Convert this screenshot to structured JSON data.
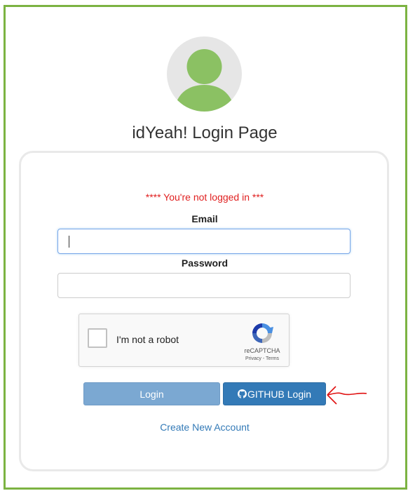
{
  "page": {
    "title": "idYeah! Login Page",
    "status_message": "**** You're not logged in ***"
  },
  "form": {
    "email_label": "Email",
    "email_value": "",
    "password_label": "Password",
    "password_value": ""
  },
  "captcha": {
    "checkbox_label": "I'm not a robot",
    "brand": "reCAPTCHA",
    "links": "Privacy - Terms"
  },
  "buttons": {
    "login": "Login",
    "github": "GITHUB Login"
  },
  "links": {
    "create_account": "Create New Account"
  },
  "colors": {
    "frame_border": "#7cb342",
    "avatar_figure": "#8bc163",
    "error_text": "#e02020",
    "primary": "#337ab7",
    "annotation_arrow": "#e01010"
  },
  "icons": [
    "user-avatar-icon",
    "github-icon",
    "recaptcha-icon",
    "annotation-arrow-icon"
  ]
}
